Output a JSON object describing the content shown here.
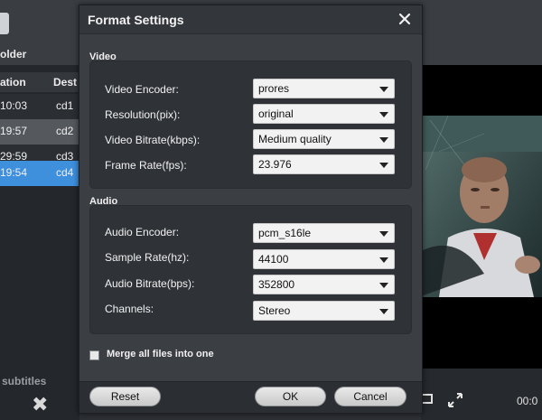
{
  "background": {
    "folder_label": "older",
    "list": {
      "headers": [
        "ation",
        "Dest"
      ],
      "rows": [
        {
          "time": "10:03",
          "dest": "cd1"
        },
        {
          "time": "19:57",
          "dest": "cd2"
        },
        {
          "time": "29:59",
          "dest": "cd3"
        },
        {
          "time": "19:54",
          "dest": "cd4"
        }
      ]
    },
    "subtitles_label": "subtitles",
    "remove_glyph": "✖",
    "time_label": "00:0"
  },
  "dialog": {
    "title": "Format Settings",
    "video": {
      "section_label": "Video",
      "fields": [
        {
          "label": "Video Encoder:",
          "value": "prores"
        },
        {
          "label": "Resolution(pix):",
          "value": "original"
        },
        {
          "label": "Video Bitrate(kbps):",
          "value": "Medium quality"
        },
        {
          "label": "Frame Rate(fps):",
          "value": "23.976"
        }
      ]
    },
    "audio": {
      "section_label": "Audio",
      "fields": [
        {
          "label": "Audio Encoder:",
          "value": "pcm_s16le"
        },
        {
          "label": "Sample Rate(hz):",
          "value": "44100"
        },
        {
          "label": "Audio Bitrate(bps):",
          "value": "352800"
        },
        {
          "label": "Channels:",
          "value": "Stereo"
        }
      ]
    },
    "merge_label": "Merge all files into one",
    "merge_checked": false,
    "buttons": {
      "reset": "Reset",
      "ok": "OK",
      "cancel": "Cancel"
    }
  },
  "colors": {
    "selection": "#3e8fdc",
    "dialog_bg": "#3b3e43"
  }
}
